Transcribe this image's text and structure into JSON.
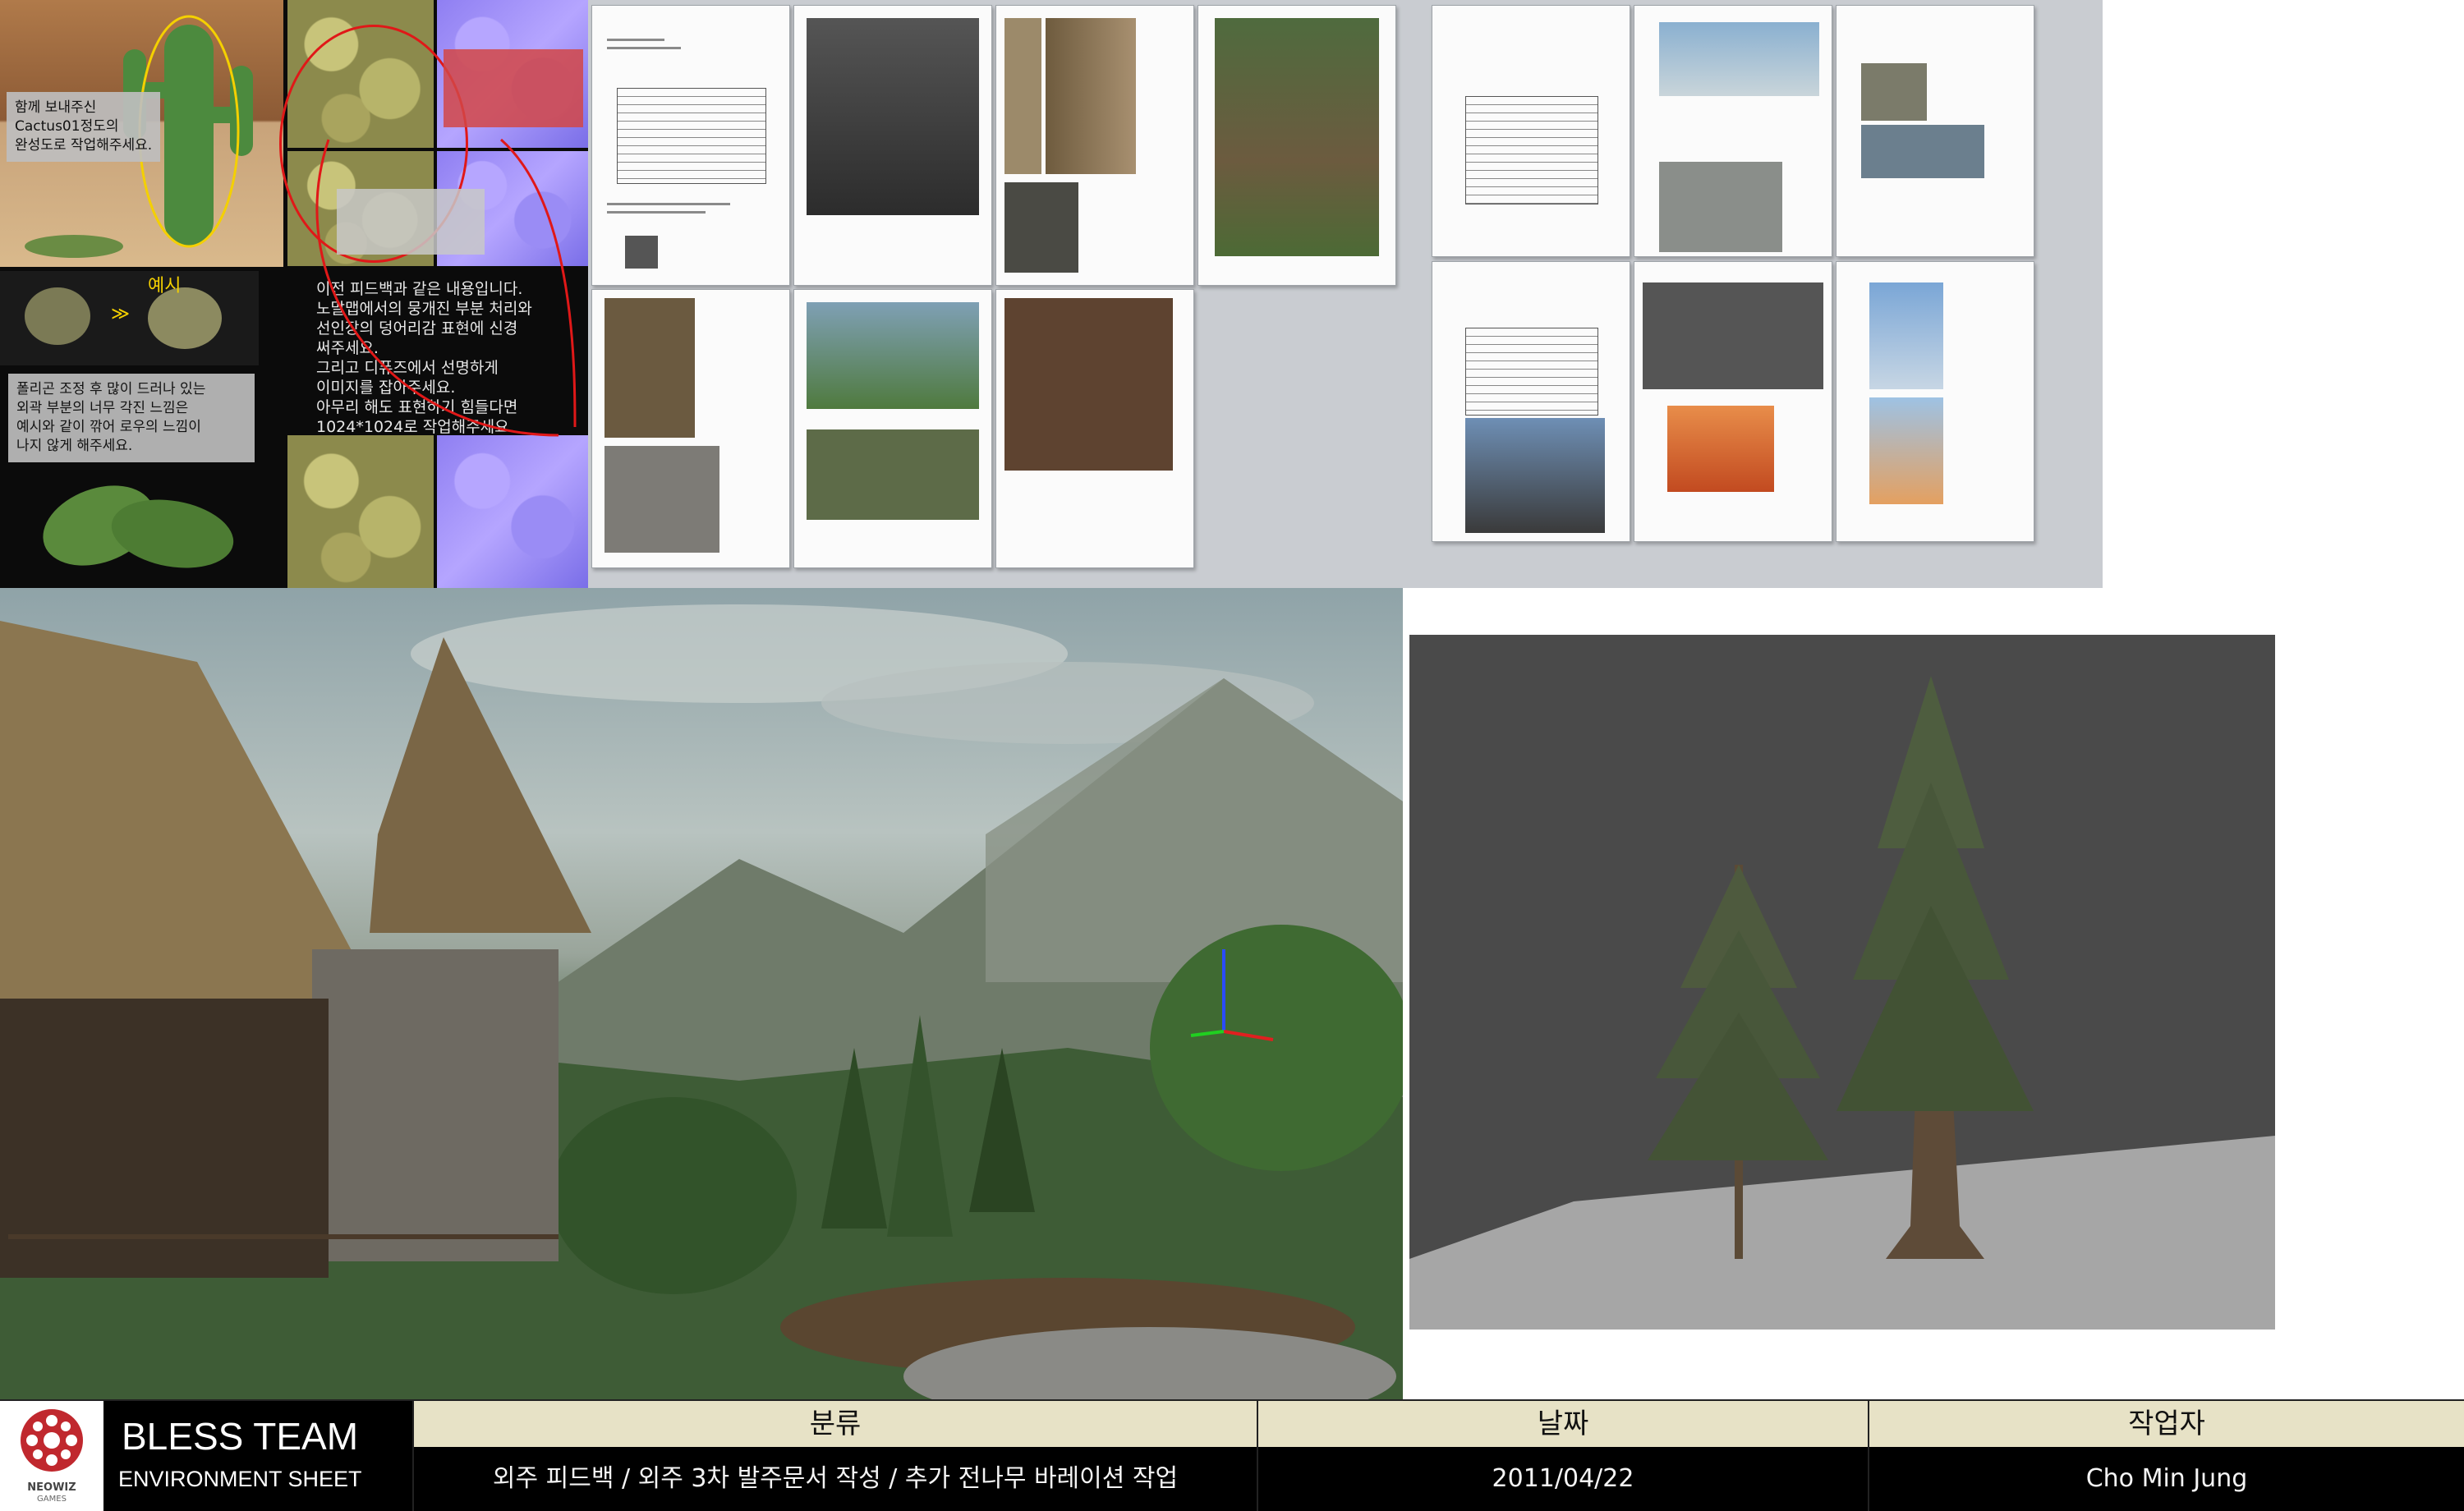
{
  "cactus_panel": {
    "note_top": "함께 보내주신\nCactus01정도의\n완성도로 작업해주세요.",
    "example_label": "예시",
    "note_poly": "폴리곤 조정 후 많이 드러나 있는\n외곽 부분의 너무 각진 느낌은\n예시와 같이 깎어 로우의 느낌이\n나지 않게 해주세요.",
    "note_feedback": "이전 피드백과 같은 내용입니다.\n노말맵에서의 뭉개진 부분 처리와\n선인장의 덩어리감 표현에 신경\n써주세요.\n그리고 디퓨즈에서 선명하게\n이미지를 잡아주세요.\n아무리 해도 표현하기 힘들다면\n1024*1024로 작업해주세요.",
    "arrow_chevron": "≫"
  },
  "footer": {
    "logo_text": "NEOWIZ",
    "logo_sub": "GAMES",
    "team_title": "BLESS TEAM",
    "sheet_title": "ENVIRONMENT SHEET",
    "category_header": "분류",
    "category_value": "외주 피드백 / 외주 3차 발주문서 작성 / 추가 전나무 바레이션 작업",
    "date_header": "날짜",
    "date_value": "2011/04/22",
    "worker_header": "작업자",
    "worker_value": "Cho Min Jung"
  },
  "colors": {
    "footer_header_bg": "#e7e2c6",
    "footer_value_bg": "#000000",
    "logo_red": "#c0282e",
    "viewport_bg": "#4a4a4a"
  }
}
